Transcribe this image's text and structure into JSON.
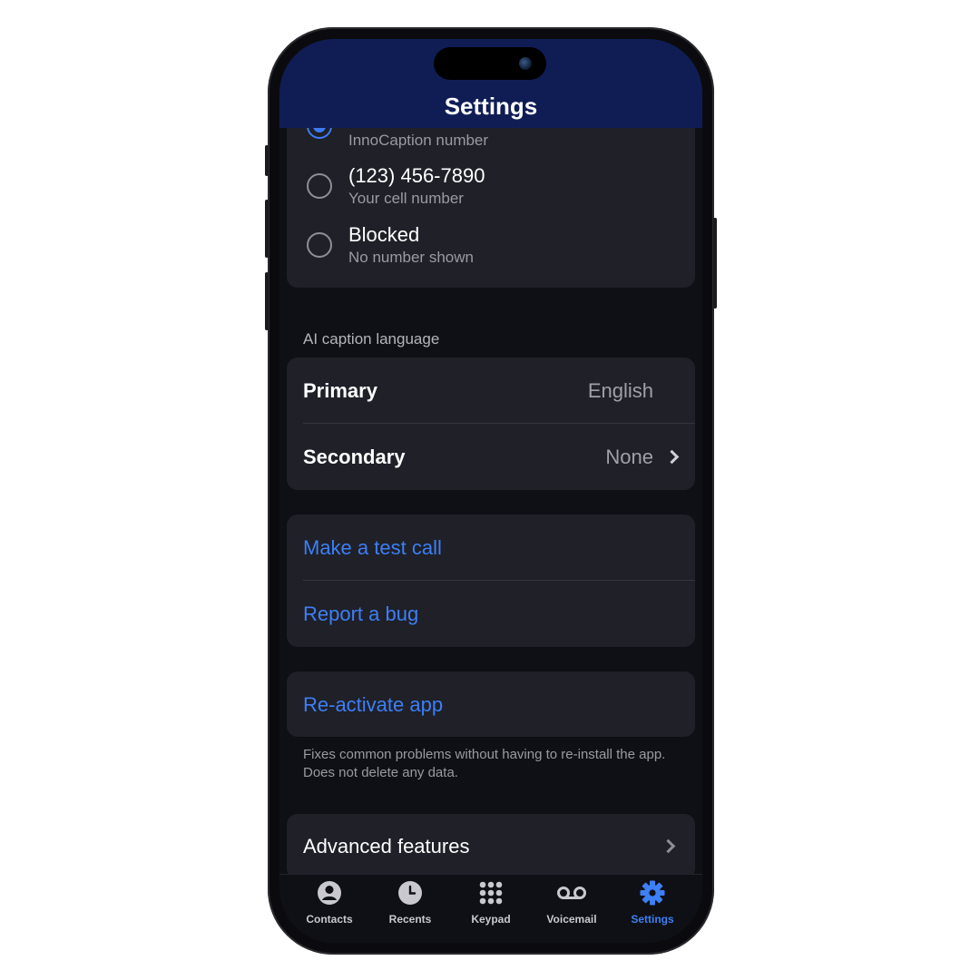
{
  "header": {
    "title": "Settings"
  },
  "caller_id": {
    "options": [
      {
        "main": "",
        "sub": "InnoCaption number",
        "selected": true
      },
      {
        "main": "(123) 456-7890",
        "sub": "Your cell number",
        "selected": false
      },
      {
        "main": "Blocked",
        "sub": "No number shown",
        "selected": false
      }
    ]
  },
  "caption_language": {
    "section_label": "AI caption language",
    "primary_label": "Primary",
    "primary_value": "English",
    "secondary_label": "Secondary",
    "secondary_value": "None"
  },
  "actions": {
    "test_call": "Make a test call",
    "report_bug": "Report a bug",
    "reactivate": "Re-activate app",
    "reactivate_note": "Fixes common problems without having to re-install the app. Does not delete any data.",
    "advanced": "Advanced features"
  },
  "tabs": [
    {
      "label": "Contacts",
      "icon": "contacts-icon",
      "active": false
    },
    {
      "label": "Recents",
      "icon": "recents-clock-icon",
      "active": false
    },
    {
      "label": "Keypad",
      "icon": "keypad-icon",
      "active": false
    },
    {
      "label": "Voicemail",
      "icon": "voicemail-icon",
      "active": false
    },
    {
      "label": "Settings",
      "icon": "settings-gear-icon",
      "active": true
    }
  ],
  "colors": {
    "header_bg": "#101d55",
    "accent": "#3d7ff5",
    "card_bg": "#1f2028",
    "screen_bg": "#0f1015"
  }
}
